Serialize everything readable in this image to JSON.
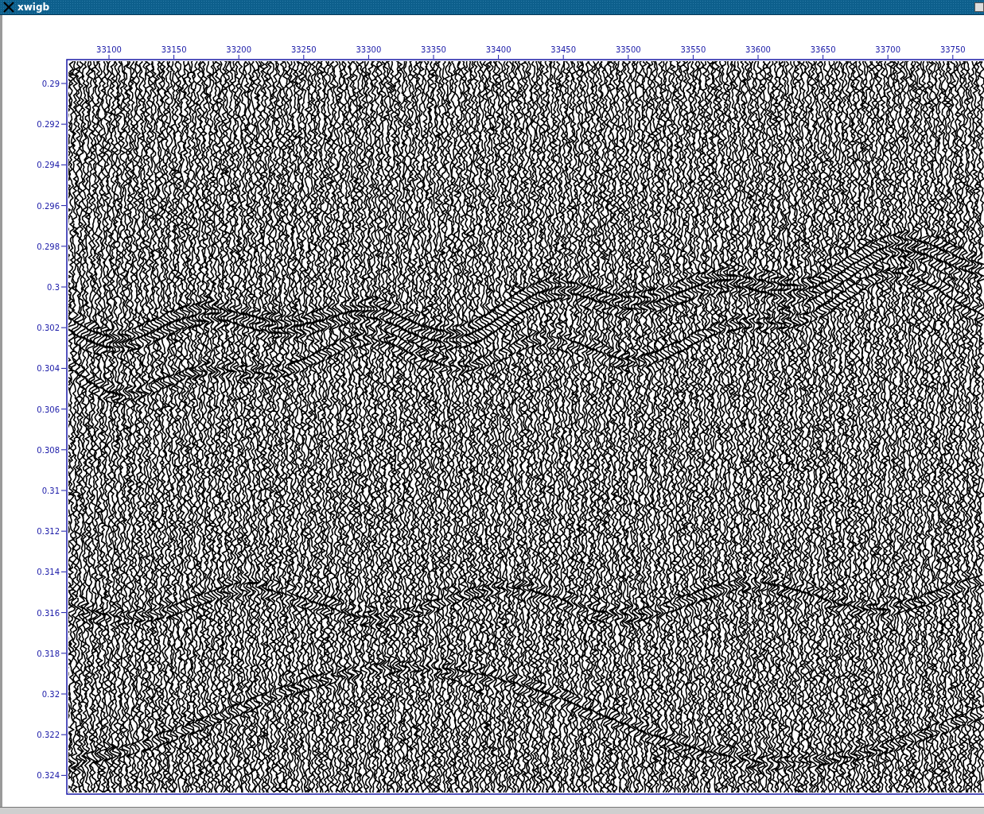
{
  "window": {
    "title": "xwigb"
  },
  "plot": {
    "x_ticks": [
      "33100",
      "33150",
      "33200",
      "33250",
      "33300",
      "33350",
      "33400",
      "33450",
      "33500",
      "33550",
      "33600",
      "33650",
      "33700",
      "33750"
    ],
    "y_ticks": [
      "0.29",
      "0.292",
      "0.294",
      "0.296",
      "0.298",
      "0.3",
      "0.302",
      "0.304",
      "0.306",
      "0.308",
      "0.31",
      "0.312",
      "0.314",
      "0.316",
      "0.318",
      "0.32",
      "0.322",
      "0.324"
    ]
  }
}
